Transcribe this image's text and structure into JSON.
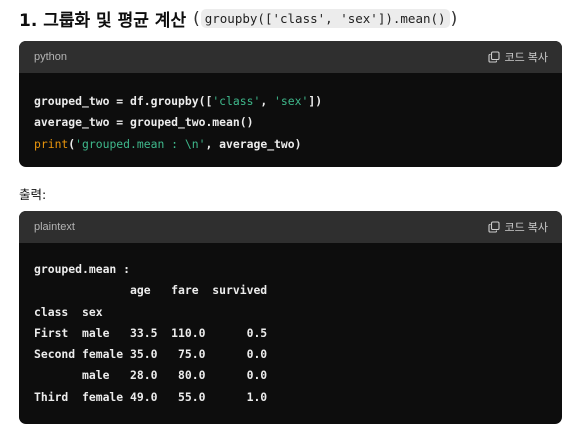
{
  "heading": {
    "title": "1. 그룹화 및 평균 계산",
    "paren_open": "(",
    "code": "groupby(['class', 'sex']).mean()",
    "paren_close": ")"
  },
  "block1": {
    "language": "python",
    "copy_label": "코드 복사",
    "lines": [
      {
        "a": "grouped_two = df.groupby([",
        "s1": "'class'",
        "b": ", ",
        "s2": "'sex'",
        "c": "])"
      },
      {
        "a": "average_two = grouped_two.mean()"
      },
      {
        "fn": "print",
        "p": "(",
        "s": "'grouped.mean : \\n'",
        "rest": ", average_two)"
      }
    ]
  },
  "output_label": "출력:",
  "block2": {
    "language": "plaintext",
    "copy_label": "코드 복사",
    "lines": [
      "grouped.mean :",
      "              age   fare  survived",
      "class  sex",
      "First  male   33.5  110.0      0.5",
      "Second female 35.0   75.0      0.0",
      "       male   28.0   80.0      0.0",
      "Third  female 49.0   55.0      1.0"
    ]
  }
}
